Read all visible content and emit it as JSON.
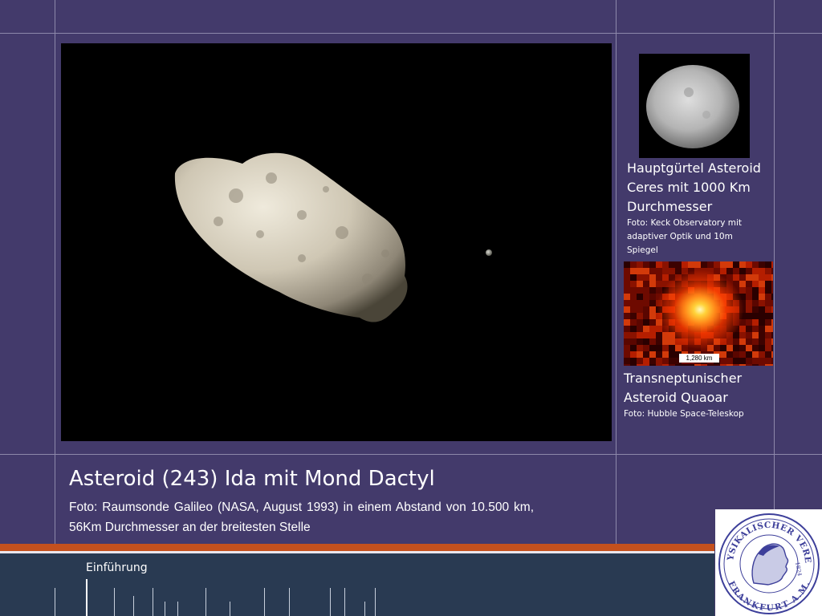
{
  "main_photo": {
    "title": "Asteroid (243) Ida mit Mond Dactyl",
    "description": "Foto: Raumsonde Galileo (NASA, August 1993) in einem Abstand von 10.500 km, 56Km Durchmesser an der breitesten Stelle"
  },
  "ceres": {
    "title": "Hauptgürtel Asteroid Ceres mit 1000 Km Durchmesser",
    "credit": "Foto: Keck Observatory mit adaptiver Optik und 10m Spiegel"
  },
  "quaoar": {
    "scale_label": "1,280 km",
    "title": "Transneptunischer Asteroid Quaoar",
    "credit": "Foto: Hubble Space-Teleskop"
  },
  "footer": {
    "section_label": "Einführung"
  },
  "logo": {
    "text_top": "PHYSIKALISCHER VEREIN",
    "text_bottom": "FRANKFURT A.M.",
    "year": "1824"
  },
  "colors": {
    "background": "#433a6b",
    "grid_line": "#8d88aa",
    "accent_stripe": "#c4501d",
    "footer_band": "#293a52",
    "logo_blue": "#3d3f9a"
  }
}
